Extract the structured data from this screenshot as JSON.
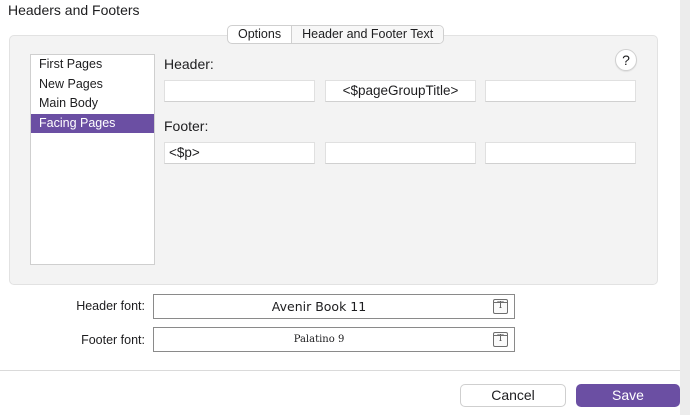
{
  "dialog": {
    "title": "Headers and Footers"
  },
  "tabs": [
    {
      "label": "Options"
    },
    {
      "label": "Header and Footer Text"
    }
  ],
  "sections": [
    {
      "label": "First Pages"
    },
    {
      "label": "New Pages"
    },
    {
      "label": "Main Body"
    },
    {
      "label": "Facing Pages"
    }
  ],
  "selected_section": "Facing Pages",
  "help": {
    "label": "?"
  },
  "header": {
    "label": "Header:",
    "left": "",
    "center": "<$pageGroupTitle>",
    "right": ""
  },
  "footer": {
    "label": "Footer:",
    "left": "<$p>",
    "center": "",
    "right": ""
  },
  "fonts": {
    "header_label": "Header font:",
    "header_value": "Avenir Book 11",
    "footer_label": "Footer font:",
    "footer_value": "Palatino 9",
    "picker_glyph": "T",
    "picker_icon": "font-picker-icon"
  },
  "buttons": {
    "cancel": "Cancel",
    "save": "Save"
  },
  "colors": {
    "accent": "#6b4fa3",
    "panel": "#f3f3f3"
  }
}
